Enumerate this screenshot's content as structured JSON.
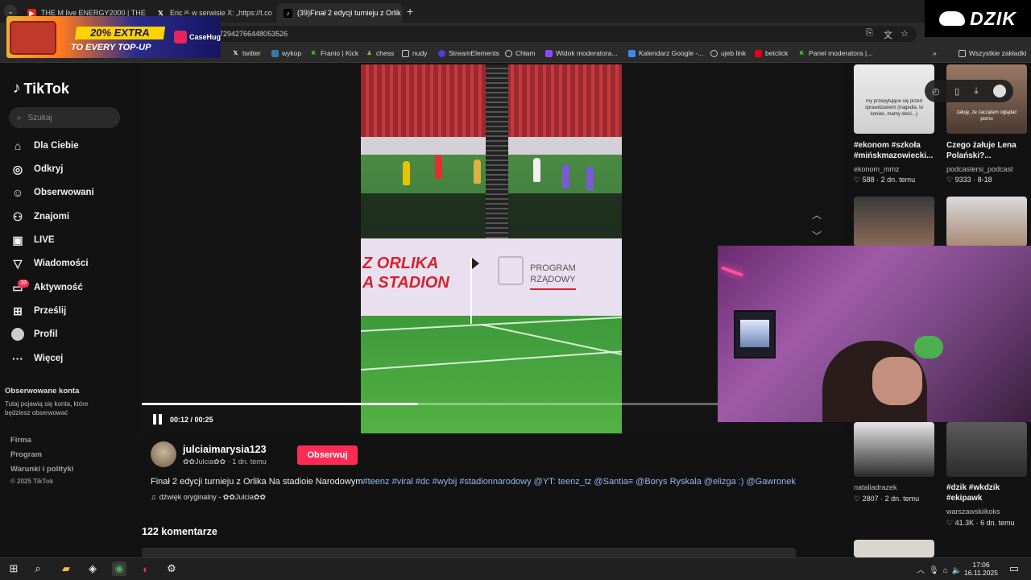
{
  "browser": {
    "tabs": [
      {
        "title": "THE M live ENERGY2000 | THE M",
        "favicon": "youtube-icon"
      },
      {
        "title": "Eric ᵖᴸ w serwisie X: „https://t.co",
        "favicon": "x-icon"
      },
      {
        "title": "(39)Finał 2 edycji turnieju z Orlik",
        "favicon": "tiktok-icon"
      }
    ],
    "url": "7294276644805352​6",
    "bookmarks": [
      {
        "label": "twitter",
        "icon": "x-icon"
      },
      {
        "label": "wykop",
        "icon": "wykop-icon"
      },
      {
        "label": "Franio | Kick",
        "icon": "kick-icon"
      },
      {
        "label": "chess",
        "icon": "chess-icon"
      },
      {
        "label": "nudy",
        "icon": "folder-icon"
      },
      {
        "label": "StreamElements",
        "icon": "streamelements-icon"
      },
      {
        "label": "Chłam",
        "icon": "globe-icon"
      },
      {
        "label": "Widok moderatora...",
        "icon": "twitch-icon"
      },
      {
        "label": "Kalendarz Google -...",
        "icon": "calendar-icon"
      },
      {
        "label": "ujeb link",
        "icon": "globe-icon"
      },
      {
        "label": "betclick",
        "icon": "betclick-icon"
      },
      {
        "label": "Panel moderatora |...",
        "icon": "kick-icon"
      }
    ],
    "all_bookmarks": "Wszystkie zakładki"
  },
  "ad": {
    "headline": "20% EXTRA",
    "subline": "TO EVERY TOP-UP",
    "brand": "CaseHug"
  },
  "overlay_logo": "DZIK",
  "tiktok": {
    "logo": "TikTok",
    "search_placeholder": "Szukaj",
    "nav": [
      {
        "label": "Dla Ciebie",
        "icon": "home-icon"
      },
      {
        "label": "Odkryj",
        "icon": "compass-icon"
      },
      {
        "label": "Obserwowani",
        "icon": "following-icon"
      },
      {
        "label": "Znajomi",
        "icon": "friends-icon"
      },
      {
        "label": "LIVE",
        "icon": "live-icon"
      },
      {
        "label": "Wiadomości",
        "icon": "messages-icon"
      },
      {
        "label": "Aktywność",
        "icon": "activity-icon"
      },
      {
        "label": "Prześlij",
        "icon": "upload-icon"
      },
      {
        "label": "Profil",
        "icon": "profile-icon"
      },
      {
        "label": "Więcej",
        "icon": "more-icon"
      }
    ],
    "activity_badge": "39",
    "followed_header": "Obserwowane konta",
    "followed_desc": "Tutaj pojawią się konta, które będziesz obserwować",
    "footer_links": [
      "Firma",
      "Program",
      "Warunki i polityki"
    ],
    "copyright": "© 2025 TikTok",
    "video": {
      "time": "00:12 / 00:25",
      "progress": 0.48,
      "board_text_1": "Z ORLIKA",
      "board_text_2": "A STADION",
      "board_text_3": "PROGRAM",
      "board_text_4": "RZĄDOWY"
    },
    "author": {
      "username": "julciaimarysia123",
      "display": "✿✿Julcia✿✿",
      "time": "1 dn. temu",
      "follow_label": "Obserwuj"
    },
    "description": "Finał 2 edycji turnieju z Orlika Na stadioie Narodowym",
    "hashtags": "#teenz #viral #dc #wybij #stadionnarodowy @YT: teenz_tz @Santia≡ @Borys Ryskala @elizga :) @Gawronek",
    "sound": "dźwięk oryginalny - ✿✿Julcia✿✿",
    "comments_count": "122 komentarze",
    "recommended": [
      {
        "title": "#ekonom #szkoła #mińskmazowiecki...",
        "author": "ekonom_mmz",
        "likes": "588",
        "age": "2 dn. temu",
        "thumb_text": "my przepytujące się przed sprawdzianem (tragedia, to koniec, mamy dość...)"
      },
      {
        "title": "Czego żałuje Lena Polański?...",
        "author": "podcastersi_podcast",
        "likes": "9333",
        "age": "8-18",
        "thumb_text": "żałuję, że zaczęłam oglądać porno"
      },
      {
        "title": "",
        "author": "nataliadrazek",
        "likes": "2807",
        "age": "2 dn. temu",
        "thumb_text": ""
      },
      {
        "title": "#dzik #wkdzik #ekipawk",
        "author": "warszawskiikoks",
        "likes": "41.3K",
        "age": "6 dn. temu",
        "thumb_text": ""
      }
    ]
  },
  "taskbar": {
    "time": "17:06",
    "date": "16.11.2025"
  }
}
